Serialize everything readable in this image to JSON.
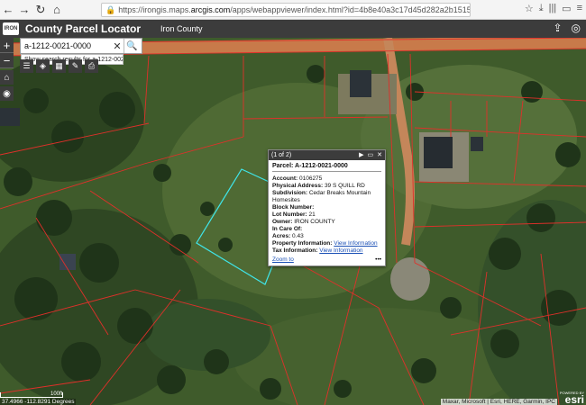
{
  "browser": {
    "url_prefix": "https://irongis.maps.",
    "url_domain": "arcgis.com",
    "url_suffix": "/apps/webappviewer/index.html?id=4b8e40a3c17d45d282a2b1515fbdd160"
  },
  "header": {
    "logo_text": "IRON",
    "title": "County Parcel Locator",
    "subtitle": "Iron County"
  },
  "search": {
    "value": "a-1212-0021-0000",
    "suggestion": "Show search results for a-1212-0021..."
  },
  "popup": {
    "counter": "(1 of 2)",
    "title": "Parcel: A-1212-0021-0000",
    "fields": {
      "account_label": "Account:",
      "account_value": "0106275",
      "address_label": "Physical Address:",
      "address_value": "39 S QUILL RD",
      "subdivision_label": "Subdivision:",
      "subdivision_value": "Cedar Breaks Mountain Homesites",
      "block_label": "Block Number:",
      "block_value": "",
      "lot_label": "Lot Number:",
      "lot_value": "21",
      "owner_label": "Owner:",
      "owner_value": "IRON COUNTY",
      "care_label": "In Care Of:",
      "care_value": "",
      "acres_label": "Acres:",
      "acres_value": "0.43",
      "property_label": "Property Information:",
      "property_link": "View Information",
      "tax_label": "Tax Information:",
      "tax_link": "View Information"
    },
    "zoom_link": "Zoom to",
    "more": "•••"
  },
  "map_footer": {
    "scale_label": "100ft",
    "coordinates": "37.4966 -112.8291 Degrees",
    "attribution": "Maxar, Microsoft | Esri, HERE, Garmin, IPC",
    "esri_powered": "POWERED BY",
    "esri_word": "esri"
  },
  "colors": {
    "parcel_line": "#e0302a",
    "selected_parcel": "#3fe6ea",
    "header_bg": "#3c3c3c",
    "road": "#c87a4a"
  }
}
